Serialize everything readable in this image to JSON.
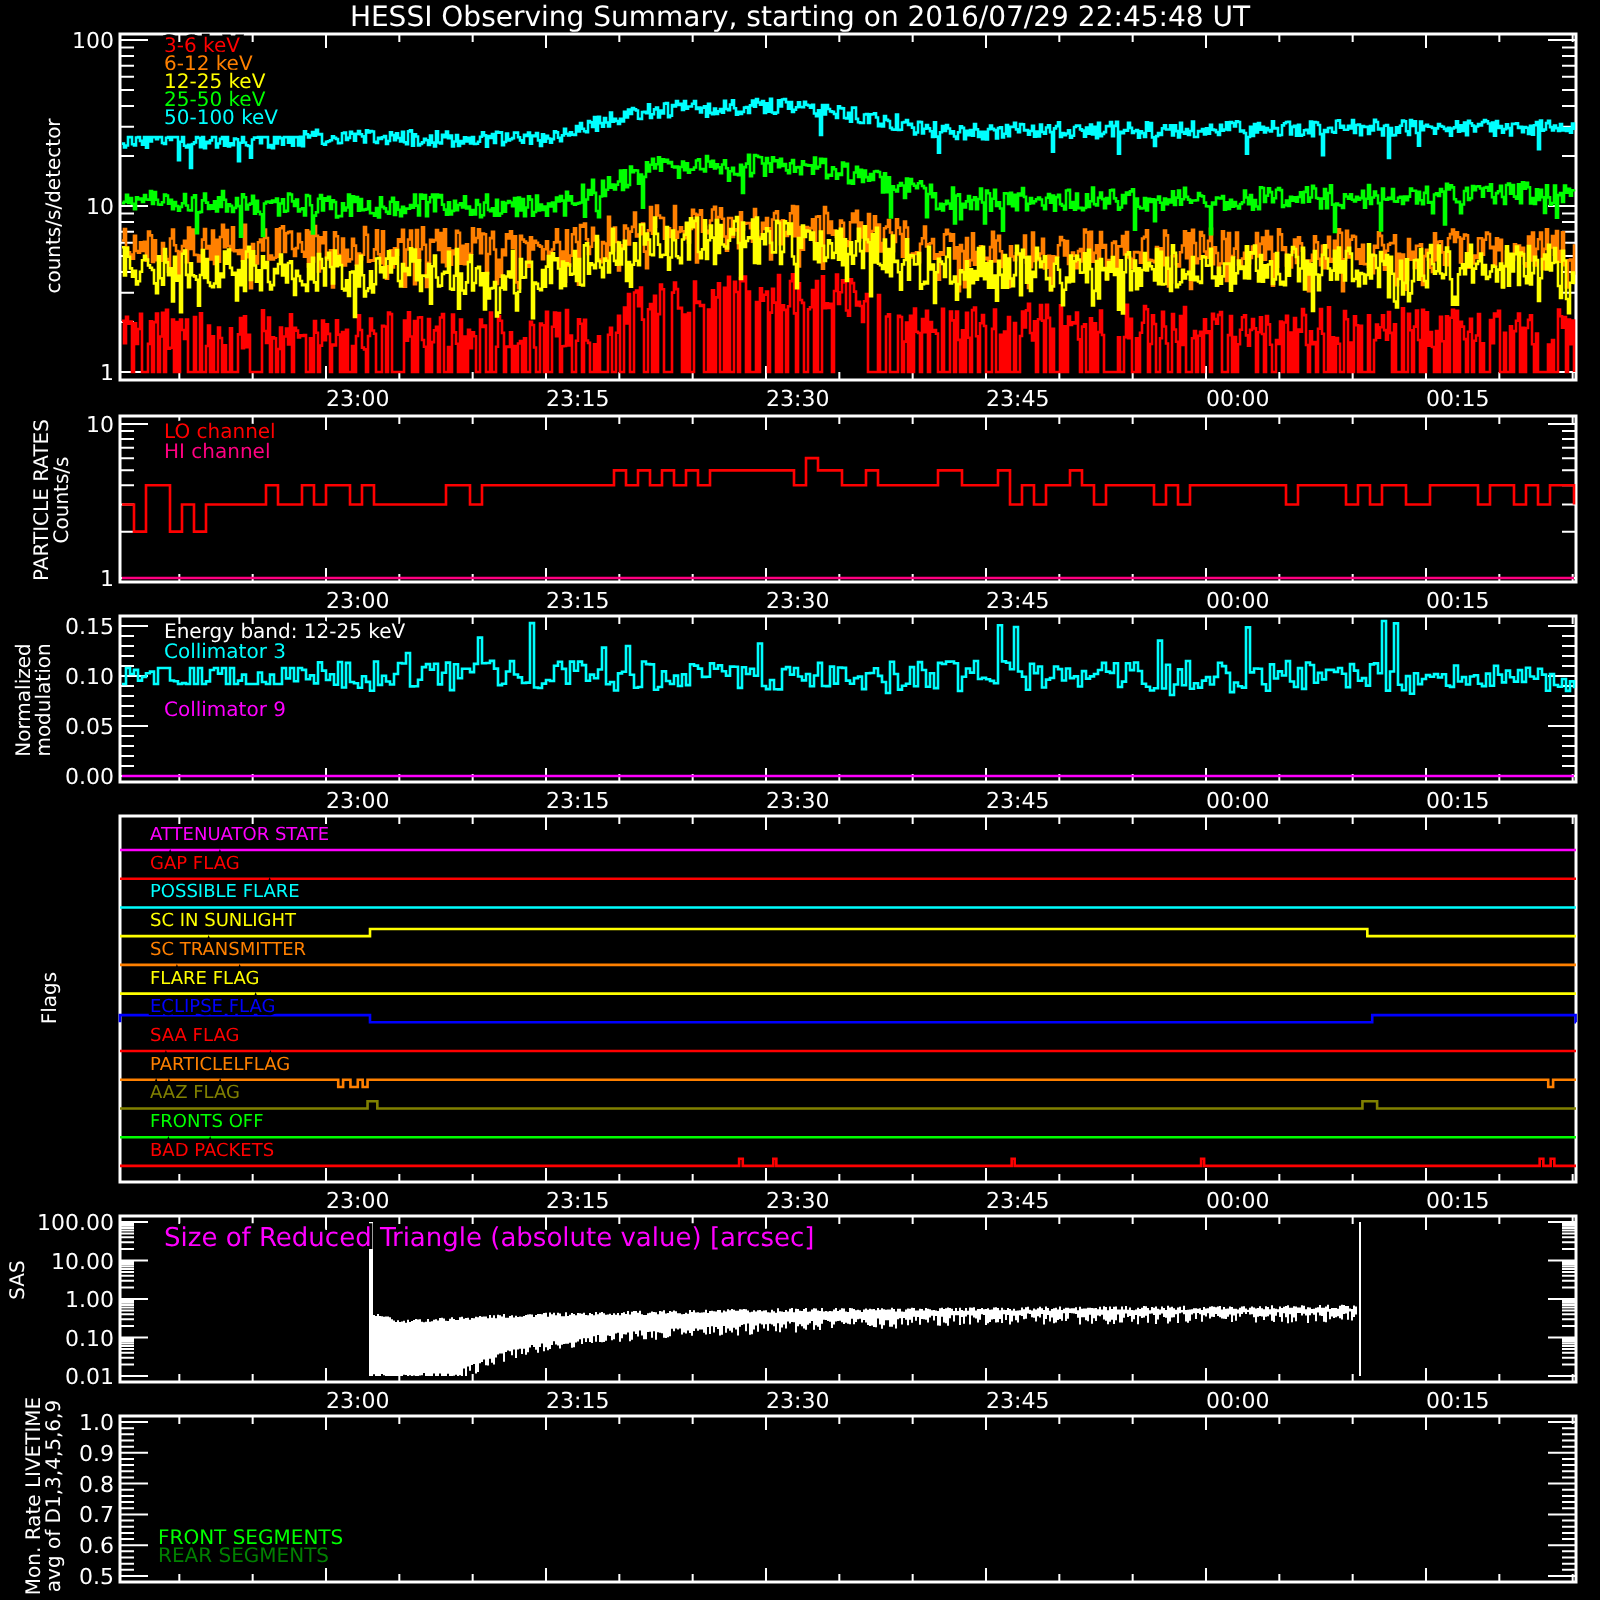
{
  "title": "HESSI Observing Summary, starting on 2016/07/29 22:45:48 UT",
  "count_rates": {
    "ylabel": [
      "counts/s/detector"
    ],
    "yticks": [
      "100",
      "10",
      "1"
    ],
    "xticks": [
      "23:00",
      "23:15",
      "23:30",
      "23:45",
      "00:00",
      "00:15"
    ],
    "legend": [
      {
        "label": "3-6 keV",
        "color": "#ff0000"
      },
      {
        "label": "6-12 keV",
        "color": "#ff8000"
      },
      {
        "label": "12-25 keV",
        "color": "#ffff00"
      },
      {
        "label": "25-50 keV",
        "color": "#00ff00"
      },
      {
        "label": "50-100 keV",
        "color": "#00ffff"
      }
    ]
  },
  "particle_rates": {
    "ylabel": [
      "PARTICLE RATES",
      "Counts/s"
    ],
    "yticks": [
      "10",
      "1"
    ],
    "xticks": [
      "23:00",
      "23:15",
      "23:30",
      "23:45",
      "00:00",
      "00:15"
    ],
    "legend": [
      {
        "label": "LO channel",
        "color": "#ff0000"
      },
      {
        "label": "HI channel",
        "color": "#ff0080"
      }
    ]
  },
  "modulation": {
    "ylabel": [
      "Normalized",
      "modulation"
    ],
    "yticks": [
      "0.15",
      "0.10",
      "0.05",
      "0.00"
    ],
    "xticks": [
      "23:00",
      "23:15",
      "23:30",
      "23:45",
      "00:00",
      "00:15"
    ],
    "legend": [
      {
        "label": "Energy band: 12-25 keV",
        "color": "#ffffff"
      },
      {
        "label": "Collimator 3",
        "color": "#00ffff"
      },
      {
        "label": "Collimator 9",
        "color": "#ff00ff"
      }
    ]
  },
  "flags": {
    "ylabel": [
      "Flags"
    ],
    "xticks": [
      "23:00",
      "23:15",
      "23:30",
      "23:45",
      "00:00",
      "00:15"
    ],
    "items": [
      {
        "label": "ATTENUATOR STATE",
        "color": "#ff00ff"
      },
      {
        "label": "GAP FLAG",
        "color": "#ff0000"
      },
      {
        "label": "POSSIBLE FLARE",
        "color": "#00ffff"
      },
      {
        "label": "SC IN SUNLIGHT",
        "color": "#ffff00"
      },
      {
        "label": "SC TRANSMITTER",
        "color": "#ff8000"
      },
      {
        "label": "FLARE FLAG",
        "color": "#ffff00"
      },
      {
        "label": "ECLIPSE FLAG",
        "color": "#0000ff"
      },
      {
        "label": "SAA FLAG",
        "color": "#ff0000"
      },
      {
        "label": "PARTICLELFLAG",
        "color": "#ff8000"
      },
      {
        "label": "AAZ FLAG",
        "color": "#808000"
      },
      {
        "label": "FRONTS OFF",
        "color": "#00ff00"
      },
      {
        "label": "BAD PACKETS",
        "color": "#ff0000"
      }
    ]
  },
  "sas": {
    "ylabel": [
      "SAS"
    ],
    "yticks": [
      "100.00",
      "10.00",
      "1.00",
      "0.10",
      "0.01"
    ],
    "xticks": [
      "23:00",
      "23:15",
      "23:30",
      "23:45",
      "00:00",
      "00:15"
    ],
    "note": {
      "text": "Size of Reduced Triangle (absolute value) [arcsec]",
      "color": "#ff00ff"
    }
  },
  "livetime": {
    "ylabel": [
      "Mon. Rate LIVETIME",
      "avg of D1,3,4,5,6,9"
    ],
    "yticks": [
      "1.0",
      "0.9",
      "0.8",
      "0.7",
      "0.6",
      "0.5"
    ],
    "legend": [
      {
        "label": "FRONT SEGMENTS",
        "color": "#00ff00"
      },
      {
        "label": "REAR SEGMENTS",
        "color": "#008000"
      }
    ]
  }
}
